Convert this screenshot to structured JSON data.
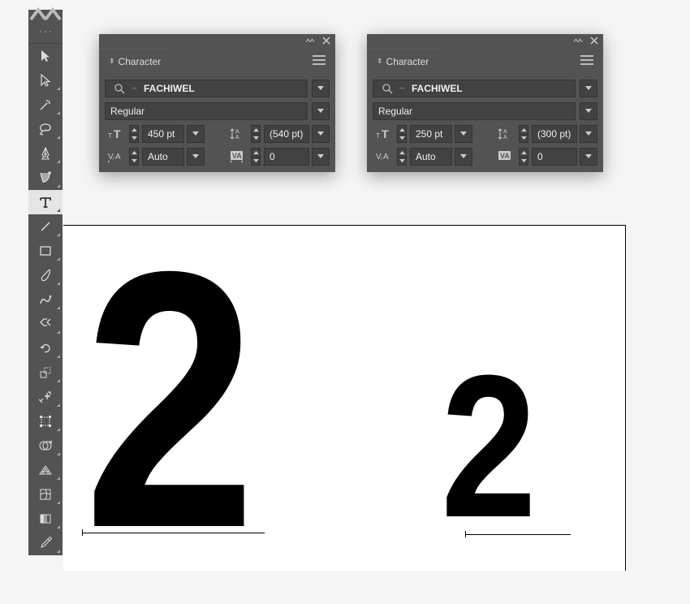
{
  "toolbar": {
    "tools": [
      {
        "name": "selection-tool-icon"
      },
      {
        "name": "direct-selection-tool-icon"
      },
      {
        "name": "magic-wand-tool-icon"
      },
      {
        "name": "lasso-tool-icon"
      },
      {
        "name": "pen-tool-icon"
      },
      {
        "name": "curvature-tool-icon"
      },
      {
        "name": "type-tool-icon",
        "active": true
      },
      {
        "name": "line-segment-tool-icon"
      },
      {
        "name": "rectangle-tool-icon"
      },
      {
        "name": "paintbrush-tool-icon"
      },
      {
        "name": "shaper-tool-icon"
      },
      {
        "name": "scissors-tool-icon"
      },
      {
        "name": "rotate-tool-icon"
      },
      {
        "name": "scale-tool-icon"
      },
      {
        "name": "width-tool-icon"
      },
      {
        "name": "free-transform-tool-icon"
      },
      {
        "name": "shape-builder-tool-icon"
      },
      {
        "name": "perspective-grid-tool-icon"
      },
      {
        "name": "mesh-tool-icon"
      },
      {
        "name": "gradient-tool-icon"
      },
      {
        "name": "eyedropper-tool-icon"
      }
    ]
  },
  "panels": [
    {
      "tab_label": "Character",
      "font_name": "FACHIWEL",
      "font_style": "Regular",
      "font_size": "450 pt",
      "leading": "(540 pt)",
      "kerning": "Auto",
      "tracking": "0"
    },
    {
      "tab_label": "Character",
      "font_name": "FACHIWEL",
      "font_style": "Regular",
      "font_size": "250 pt",
      "leading": "(300 pt)",
      "kerning": "Auto",
      "tracking": "0"
    }
  ],
  "canvas": {
    "glyph": "2"
  }
}
